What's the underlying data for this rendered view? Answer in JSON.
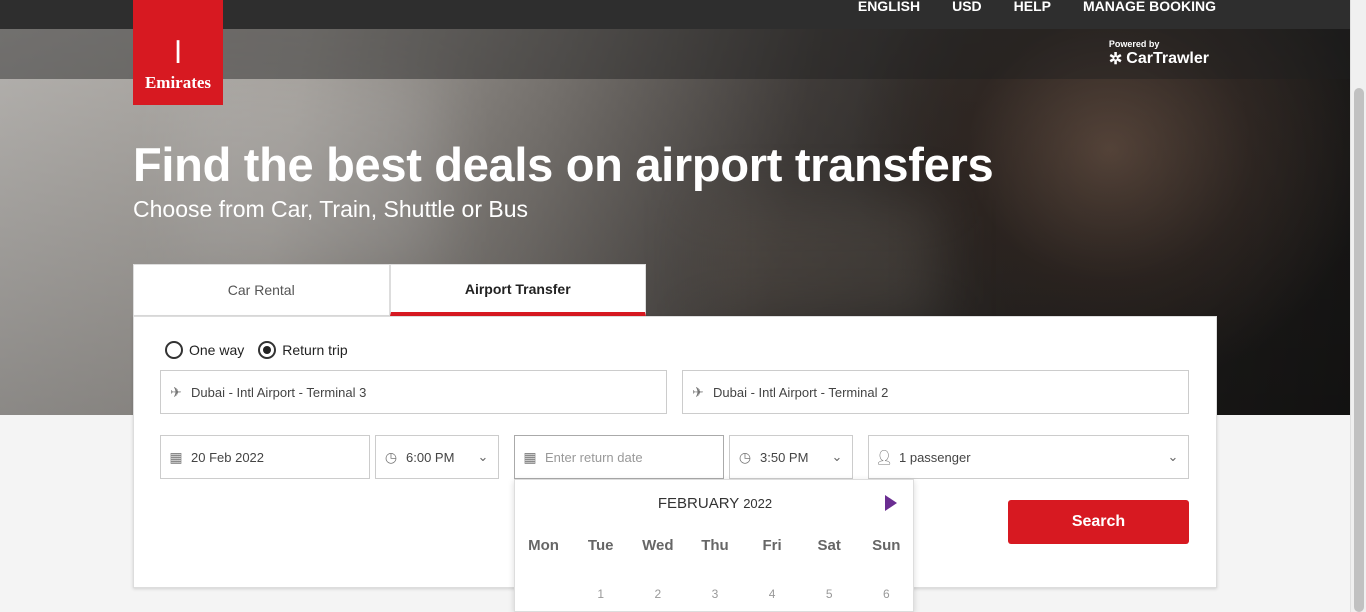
{
  "nav": {
    "language": "ENGLISH",
    "currency": "USD",
    "help": "HELP",
    "manage_booking": "MANAGE BOOKING"
  },
  "logo": {
    "text": "Emirates",
    "color": "#d71921"
  },
  "powered": {
    "label": "Powered by",
    "brand": "CarTrawler"
  },
  "hero": {
    "headline": "Find the best deals on airport transfers",
    "subline": "Choose from Car, Train, Shuttle or Bus"
  },
  "tabs": [
    {
      "label": "Car Rental",
      "active": false
    },
    {
      "label": "Airport Transfer",
      "active": true
    }
  ],
  "trip_type": {
    "one_way": "One way",
    "return_trip": "Return trip",
    "selected": "return_trip"
  },
  "pickup": {
    "value": "Dubai - Intl Airport - Terminal 3",
    "icon": "plane-icon"
  },
  "dropoff": {
    "value": "Dubai - Intl Airport - Terminal 2",
    "icon": "plane-icon"
  },
  "depart_date": {
    "value": "20 Feb 2022",
    "icon": "calendar-icon"
  },
  "depart_time": {
    "value": "6:00 PM",
    "icon": "clock-icon"
  },
  "return_date": {
    "placeholder": "Enter return date",
    "icon": "calendar-icon"
  },
  "return_time": {
    "value": "3:50 PM",
    "icon": "clock-icon"
  },
  "passengers": {
    "value": "1 passenger",
    "icon": "person-icon"
  },
  "search_label": "Search",
  "calendar": {
    "month": "FEBRUARY",
    "year": "2022",
    "weekdays": [
      "Mon",
      "Tue",
      "Wed",
      "Thu",
      "Fri",
      "Sat",
      "Sun"
    ],
    "first_row": [
      "",
      "1",
      "2",
      "3",
      "4",
      "5",
      "6"
    ]
  },
  "colors": {
    "accent": "#d71921",
    "calendar_arrow": "#6a2d91"
  }
}
